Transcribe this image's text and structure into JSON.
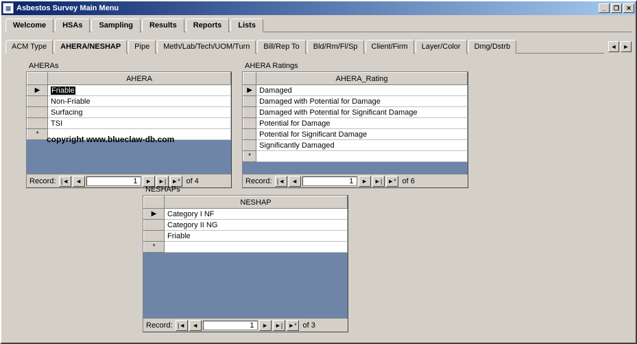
{
  "window": {
    "title": "Asbestos Survey Main Menu"
  },
  "main_tabs": [
    "Welcome",
    "HSAs",
    "Sampling",
    "Results",
    "Reports",
    "Lists"
  ],
  "main_tab_active": "Lists",
  "sub_tabs": [
    "ACM Type",
    "AHERA/NESHAP",
    "Pipe",
    "Meth/Lab/Tech/UOM/Turn",
    "Bill/Rep To",
    "Bld/Rm/Fl/Sp",
    "Client/Firm",
    "Layer/Color",
    "Dmg/Dstrb"
  ],
  "sub_tab_active": "AHERA/NESHAP",
  "watermark": "copyright www.blueclaw-db.com",
  "grids": {
    "aheras": {
      "label": "AHERAs",
      "header": "AHERA",
      "rows": [
        "Friable",
        "Non-Friable",
        "Surfacing",
        "TSI"
      ],
      "selected_index": 0,
      "nav": {
        "label": "Record:",
        "current": "1",
        "of_text": "of  4"
      }
    },
    "ratings": {
      "label": "AHERA Ratings",
      "header": "AHERA_Rating",
      "rows": [
        "Damaged",
        "Damaged with Potential for Damage",
        "Damaged with Potential for Significant Damage",
        "Potential for Damage",
        "Potential for Significant Damage",
        "Significantly Damaged"
      ],
      "nav": {
        "label": "Record:",
        "current": "1",
        "of_text": "of  6"
      }
    },
    "neshaps": {
      "label": "NESHAPs",
      "header": "NESHAP",
      "rows": [
        "Category I NF",
        "Category II NG",
        "Friable"
      ],
      "nav": {
        "label": "Record:",
        "current": "1",
        "of_text": "of  3"
      }
    }
  }
}
